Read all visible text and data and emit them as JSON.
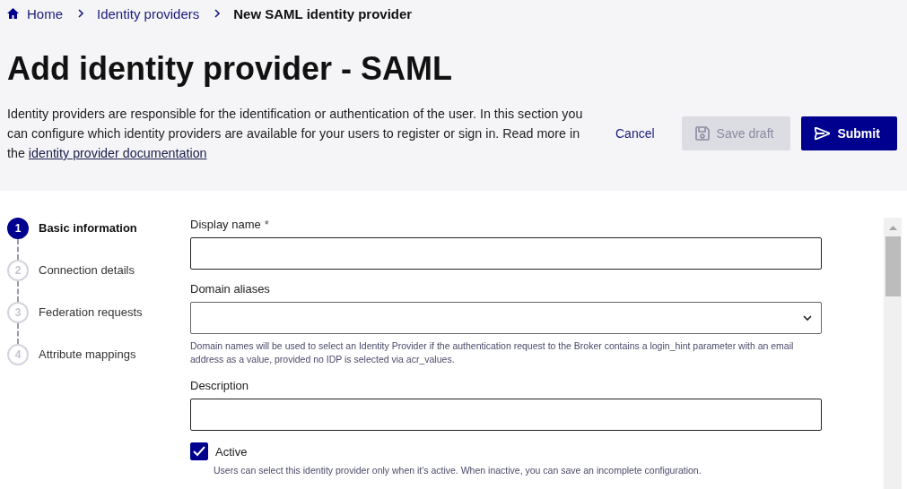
{
  "breadcrumb": [
    {
      "label": "Home",
      "kind": "home"
    },
    {
      "label": "Identity providers",
      "kind": "link"
    },
    {
      "label": "New SAML identity provider",
      "kind": "current"
    }
  ],
  "title": "Add identity provider - SAML",
  "description": {
    "text": "Identity providers are responsible for the identification or authentication of the user. In this section you can configure which identity providers are available for your users to register or sign in. Read more in the",
    "link": "identity provider documentation"
  },
  "actions": [
    {
      "label": "Cancel",
      "kind": "link"
    },
    {
      "label": "Save draft",
      "kind": "save",
      "disabled": true
    },
    {
      "label": "Submit",
      "kind": "submit"
    }
  ],
  "steps": [
    {
      "number": "1",
      "label": "Basic information",
      "selected": true
    },
    {
      "number": "2",
      "label": "Connection details",
      "selected": false
    },
    {
      "number": "3",
      "label": "Federation requests",
      "selected": false
    },
    {
      "number": "4",
      "label": "Attribute mappings",
      "selected": false
    }
  ],
  "fields": [
    {
      "label": "Display name",
      "required": "*",
      "kind": "text"
    },
    {
      "label": "Domain aliases",
      "kind": "select",
      "help": "Domain names will be used to select an Identity Provider if the authentication request to the Broker contains a login_hint parameter with an email address as a value, provided no IDP is selected via acr_values."
    },
    {
      "label": "Description",
      "kind": "text"
    }
  ],
  "active": {
    "label": "Active",
    "checked": true,
    "help": "Users can select this identity provider only when it's active. When inactive, you can save an incomplete configuration."
  }
}
